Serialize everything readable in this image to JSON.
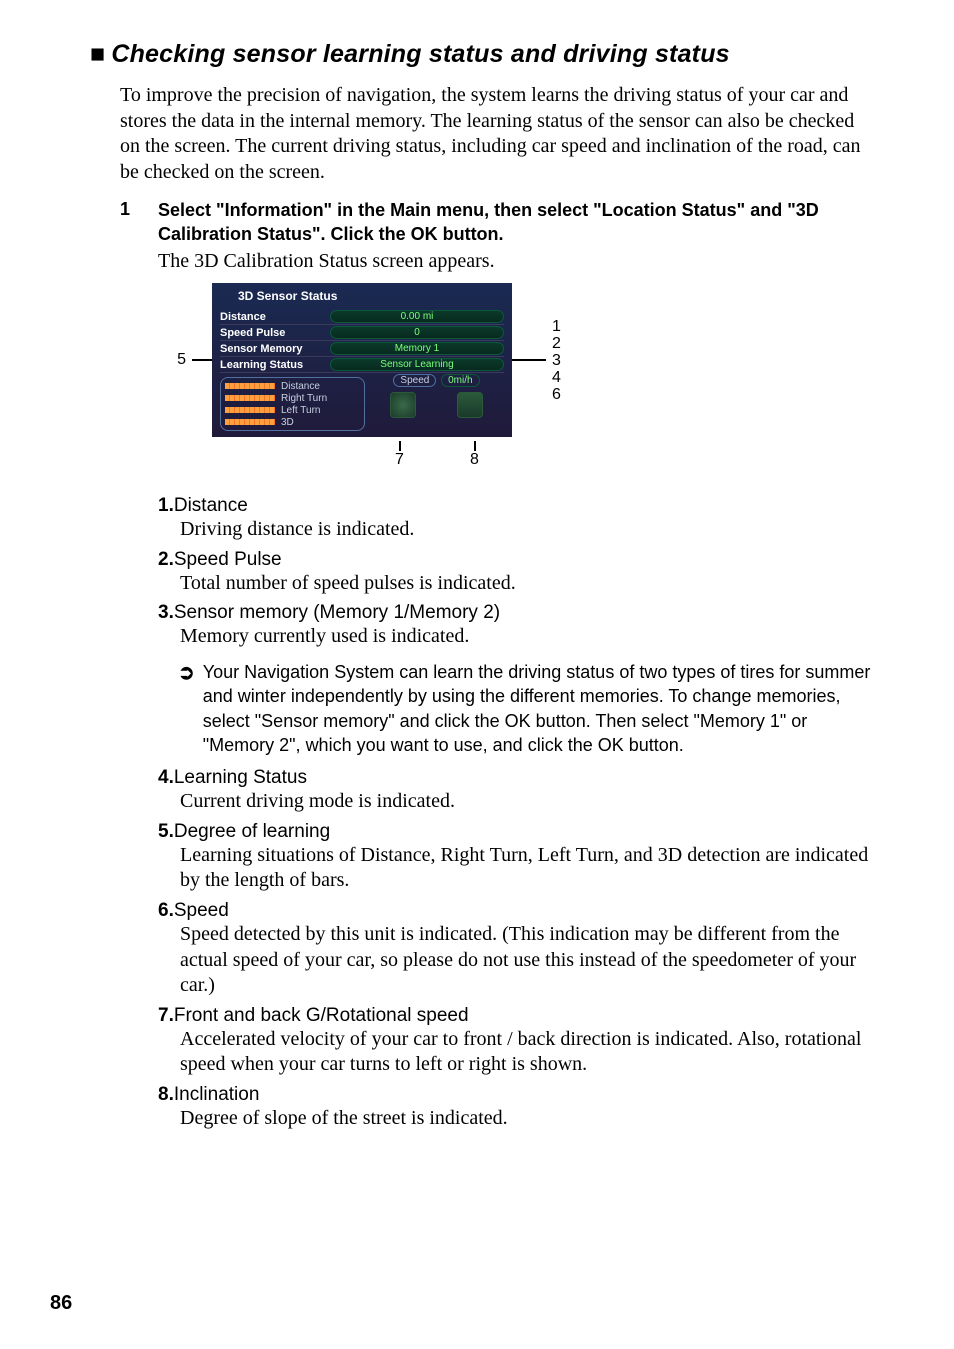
{
  "section": {
    "bullet": "■",
    "title": "Checking sensor learning status and driving status",
    "intro": "To improve the precision of navigation, the system learns the driving status of your car and stores the data in the internal memory. The learning status of the sensor can also be checked on the screen. The current driving status, including car speed and inclination of the road, can be checked on the screen."
  },
  "step": {
    "num": "1",
    "text": "Select \"Information\" in the Main menu, then select \"Location Status\" and \"3D Calibration Status\". Click the OK button.",
    "desc": "The 3D Calibration Status screen appears."
  },
  "figure": {
    "title": "3D Sensor Status",
    "rows": [
      {
        "label": "Distance",
        "value": "0.00 mi"
      },
      {
        "label": "Speed Pulse",
        "value": "0"
      },
      {
        "label": "Sensor Memory",
        "value": "Memory 1"
      },
      {
        "label": "Learning Status",
        "value": "Sensor Learning"
      }
    ],
    "speed": {
      "label": "Speed",
      "value": "0mi/h"
    },
    "bars": [
      {
        "label": "Distance"
      },
      {
        "label": "Right Turn"
      },
      {
        "label": "Left Turn"
      },
      {
        "label": "3D"
      }
    ],
    "callouts": {
      "left": "5",
      "right": [
        "1",
        "2",
        "3",
        "4",
        "6"
      ],
      "bottom": [
        "7",
        "8"
      ]
    }
  },
  "defs": [
    {
      "num": "1.",
      "title": "Distance",
      "body": "Driving distance is indicated."
    },
    {
      "num": "2.",
      "title": "Speed Pulse",
      "body": "Total number of speed pulses is indicated."
    },
    {
      "num": "3.",
      "title": "Sensor memory (Memory 1/Memory 2)",
      "body": "Memory currently used is indicated."
    },
    {
      "num": "4.",
      "title": "Learning Status",
      "body": "Current driving mode is indicated."
    },
    {
      "num": "5.",
      "title": "Degree of learning",
      "body": "Learning situations of Distance, Right Turn, Left Turn, and 3D detection are indicated by the length of bars."
    },
    {
      "num": "6.",
      "title": "Speed",
      "body": "Speed detected by this unit is indicated. (This indication may be different from the actual speed of your car, so please do not use this instead of the speedometer of your car.)"
    },
    {
      "num": "7.",
      "title": "Front and back G/Rotational speed",
      "body": "Accelerated velocity of your car to front / back direction is indicated. Also, rotational speed when your car turns to left or right is shown."
    },
    {
      "num": "8.",
      "title": "Inclination",
      "body": "Degree of slope of the street is indicated."
    }
  ],
  "note": {
    "icon": "➲",
    "text": "Your Navigation System can learn the driving status of two types of tires for summer and winter independently by using the different memories. To change memories, select \"Sensor memory\" and click the OK button. Then select \"Memory 1\" or \"Memory 2\", which you want to use, and click the OK button."
  },
  "page_number": "86"
}
